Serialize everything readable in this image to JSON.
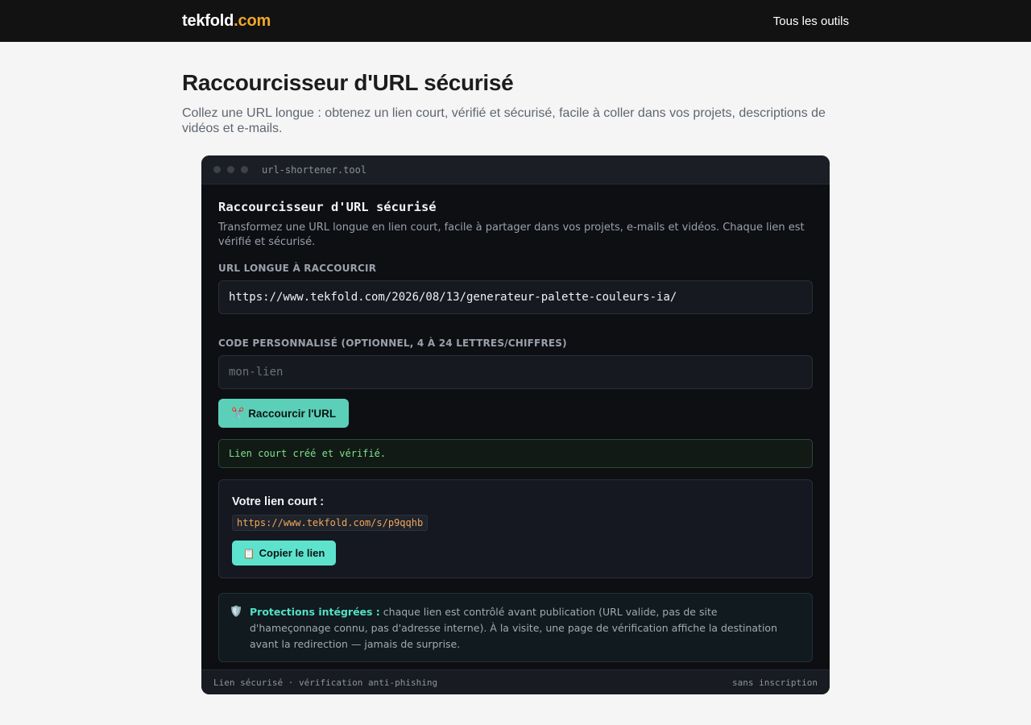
{
  "header": {
    "brand_name": "tekfold",
    "brand_tld": ".com",
    "nav_all_tools": "Tous les outils"
  },
  "page": {
    "title": "Raccourcisseur d'URL sécurisé",
    "subtitle": "Collez une URL longue : obtenez un lien court, vérifié et sécurisé, facile à coller dans vos projets, descriptions de vidéos et e-mails."
  },
  "tool_window": {
    "title": "url-shortener.tool",
    "tool_title": "Raccourcisseur d'URL sécurisé",
    "tool_description": "Transformez une URL longue en lien court, facile à partager dans vos projets, e-mails et vidéos. Chaque lien est vérifié et sécurisé.",
    "long_url_label": "URL LONGUE À RACCOURCIR",
    "long_url_value": "https://www.tekfold.com/2026/08/13/generateur-palette-couleurs-ia/",
    "custom_code_label": "CODE PERSONNALISÉ (OPTIONNEL, 4 À 24 LETTRES/CHIFFRES)",
    "custom_code_placeholder": "mon-lien",
    "custom_code_value": "",
    "shorten_button": "Raccourcir l'URL",
    "status_message": "Lien court créé et vérifié.",
    "result_label": "Votre lien court :",
    "short_link": "https://www.tekfold.com/s/p9qqhb",
    "copy_button": "Copier le lien",
    "protection_title": "Protections intégrées :",
    "protection_text": " chaque lien est contrôlé avant publication (URL valide, pas de site d'hameçonnage connu, pas d'adresse interne). À la visite, une page de vérification affiche la destination avant la redirection — jamais de surprise.",
    "footer_left": "Lien sécurisé · vérification anti-phishing",
    "footer_right": "sans inscription"
  },
  "icons": {
    "scissors": "scissors-icon",
    "clipboard": "clipboard-icon",
    "shield": "shield-icon"
  },
  "colors": {
    "accent": "#5ccfb8",
    "copy_button": "#5de3cd",
    "brand_tld": "#f0a72a",
    "success_text": "#7fe08f",
    "short_link": "#f0a75a"
  }
}
